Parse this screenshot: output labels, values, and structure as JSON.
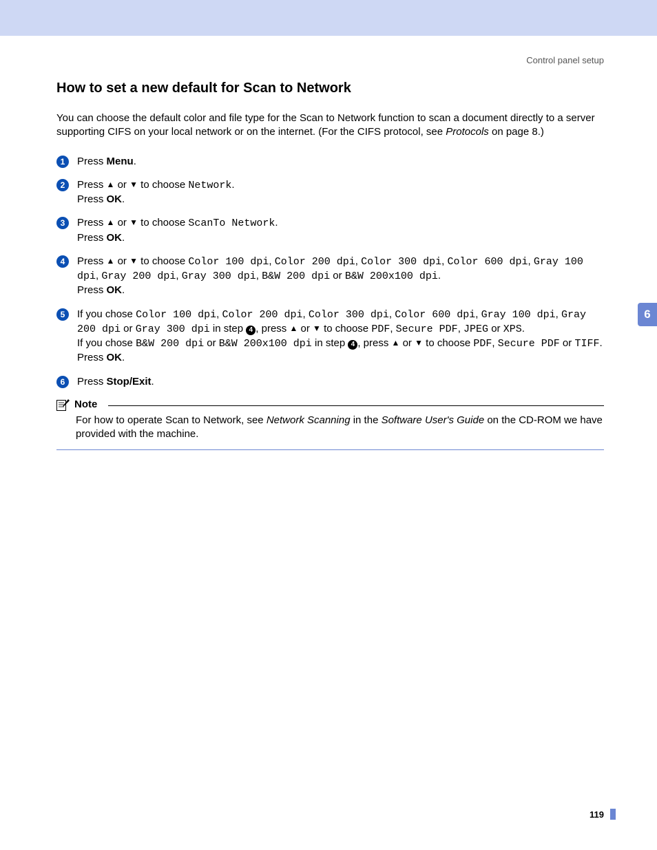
{
  "header": {
    "breadcrumb": "Control panel setup"
  },
  "section": {
    "title": "How to set a new default for Scan to Network",
    "intro_a": "You can choose the default color and file type for the Scan to Network function to scan a document directly to a server supporting CIFS on your local network or on the internet. (For the CIFS protocol, see ",
    "intro_italic": "Protocols",
    "intro_b": " on page 8.)"
  },
  "glyph": {
    "up": "▲",
    "down": "▼"
  },
  "steps": {
    "s1": {
      "a": "Press ",
      "menu": "Menu",
      "dot": "."
    },
    "s2": {
      "a": "Press ",
      "b": " or ",
      "c": " to choose ",
      "network": "Network",
      "d": ".",
      "e": "Press ",
      "ok": "OK",
      "f": "."
    },
    "s3": {
      "a": "Press ",
      "b": " or ",
      "c": " to choose ",
      "scanto": "ScanTo Network",
      "d": ".",
      "e": "Press ",
      "ok": "OK",
      "f": "."
    },
    "s4": {
      "a": "Press ",
      "b": " or ",
      "c": " to choose ",
      "opt1": "Color 100 dpi",
      "opt2": "Color 200 dpi",
      "opt3": "Color 300 dpi",
      "opt4": "Color 600 dpi",
      "opt5": "Gray 100 dpi",
      "opt6": "Gray 200 dpi",
      "opt7": "Gray 300 dpi",
      "opt8": "B&W 200 dpi",
      "or": " or ",
      "opt9": "B&W 200x100 dpi",
      "d": ".",
      "e": "Press ",
      "ok": "OK",
      "f": "."
    },
    "s5": {
      "a": "If you chose ",
      "o1": "Color 100 dpi",
      "o2": "Color 200 dpi",
      "o3": "Color 300 dpi",
      "o4": "Color 600 dpi",
      "o5": "Gray 100 dpi",
      "o6": "Gray 200 dpi",
      "or": " or ",
      "o7": "Gray 300 dpi",
      "b": " in step ",
      "ref4": "4",
      "c": ", press ",
      "d": " or ",
      "e": " to choose ",
      "f1": "PDF",
      "f2": "Secure PDF",
      "f3": "JPEG",
      "f4": "XPS",
      "dot": ".",
      "g": "If you chose ",
      "o8": "B&W 200 dpi",
      "o9": "B&W 200x100 dpi",
      "h": " in step ",
      "i": ", press ",
      "j": " or ",
      "k": " to choose ",
      "f5": "PDF",
      "f6": "Secure PDF",
      "or2": " or ",
      "f7": "TIFF",
      "dot2": ".",
      "l": "Press ",
      "ok": "OK",
      "m": "."
    },
    "s6": {
      "a": "Press ",
      "stopexit": "Stop/Exit",
      "dot": "."
    }
  },
  "note": {
    "label": "Note",
    "a": "For how to operate Scan to Network, see ",
    "i1": "Network Scanning",
    "b": " in the ",
    "i2": "Software User's Guide",
    "c": " on the CD-ROM we have provided with the machine."
  },
  "tab": {
    "chapter": "6"
  },
  "footer": {
    "page": "119"
  }
}
